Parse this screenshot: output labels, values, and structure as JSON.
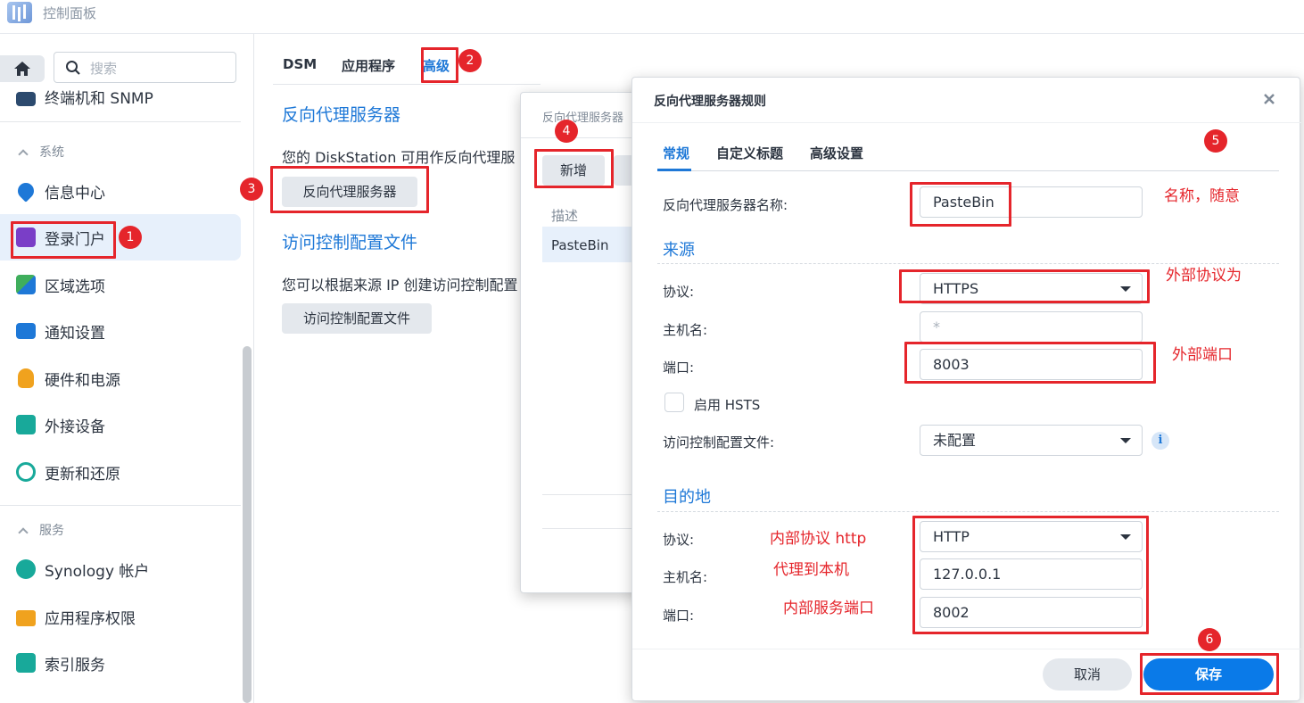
{
  "app": {
    "title": "控制面板"
  },
  "sidebar": {
    "search_placeholder": "搜索",
    "items": [
      {
        "label": "终端机和 SNMP"
      },
      {
        "label": "信息中心"
      },
      {
        "label": "登录门户"
      },
      {
        "label": "区域选项"
      },
      {
        "label": "通知设置"
      },
      {
        "label": "硬件和电源"
      },
      {
        "label": "外接设备"
      },
      {
        "label": "更新和还原"
      },
      {
        "label": "Synology 帐户"
      },
      {
        "label": "应用程序权限"
      },
      {
        "label": "索引服务"
      }
    ],
    "sections": {
      "system": "系统",
      "services": "服务"
    }
  },
  "main": {
    "tabs": [
      {
        "label": "DSM"
      },
      {
        "label": "应用程序"
      },
      {
        "label": "高级"
      }
    ],
    "reverse_proxy": {
      "heading": "反向代理服务器",
      "desc": "您的 DiskStation 可用作反向代理服",
      "button": "反向代理服务器"
    },
    "access_control": {
      "heading": "访问控制配置文件",
      "desc": "您可以根据来源 IP 创建访问控制配置",
      "button": "访问控制配置文件"
    }
  },
  "list_dialog": {
    "title": "反向代理服务器",
    "add_button": "新增",
    "column_desc": "描述",
    "row_value": "PasteBin"
  },
  "rule_dialog": {
    "title": "反向代理服务器规则",
    "tabs": [
      {
        "label": "常规"
      },
      {
        "label": "自定义标题"
      },
      {
        "label": "高级设置"
      }
    ],
    "name_label": "反向代理服务器名称:",
    "name_value": "PasteBin",
    "source": {
      "heading": "来源",
      "protocol_label": "协议:",
      "protocol_value": "HTTPS",
      "hostname_label": "主机名:",
      "hostname_value": "*",
      "port_label": "端口:",
      "port_value": "8003",
      "hsts_label": "启用 HSTS",
      "hsts_checked": false,
      "access_label": "访问控制配置文件:",
      "access_value": "未配置"
    },
    "destination": {
      "heading": "目的地",
      "protocol_label": "协议:",
      "protocol_value": "HTTP",
      "hostname_label": "主机名:",
      "hostname_value": "127.0.0.1",
      "port_label": "端口:",
      "port_value": "8002"
    },
    "cancel_label": "取消",
    "save_label": "保存"
  },
  "annotations": {
    "badges": [
      "1",
      "2",
      "3",
      "4",
      "5",
      "6"
    ],
    "name_note": "名称，随意",
    "ext_protocol_note": "外部协议为",
    "ext_port_note": "外部端口",
    "int_protocol_note": "内部协议 http",
    "proxy_note": "代理到本机",
    "int_port_note": "内部服务端口"
  },
  "colors": {
    "accent": "#1e78d7",
    "annotation": "#e5252b",
    "selected_bg": "#e7f0fb",
    "primary_button": "#0a7ae8"
  }
}
